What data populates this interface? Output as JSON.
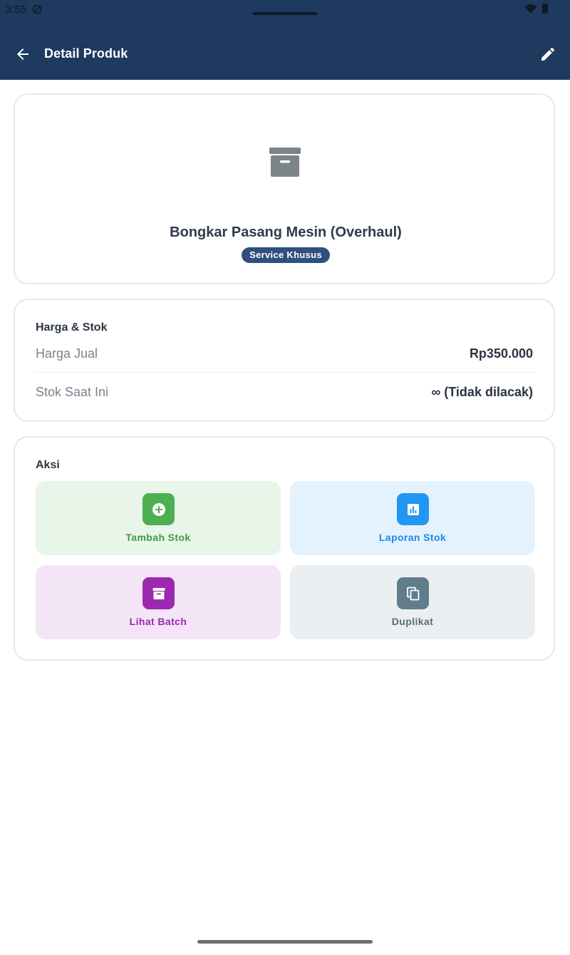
{
  "status_bar": {
    "time": "3:55",
    "icons": [
      "do-not-disturb-icon",
      "wifi-icon",
      "battery-icon"
    ]
  },
  "app_bar": {
    "title": "Detail Produk",
    "back_icon": "arrow-left-icon",
    "edit_icon": "pencil-icon",
    "background": "#1e3a5f"
  },
  "product": {
    "icon": "archive-box-icon",
    "name": "Bongkar Pasang Mesin (Overhaul)",
    "category_badge": "Service Khusus"
  },
  "price_stock": {
    "section_title": "Harga & Stok",
    "rows": [
      {
        "label": "Harga Jual",
        "value": "Rp350.000"
      },
      {
        "label": "Stok Saat Ini",
        "value": "∞ (Tidak dilacak)"
      }
    ]
  },
  "actions": {
    "section_title": "Aksi",
    "items": [
      {
        "label": "Tambah Stok",
        "icon": "plus-circle-icon",
        "color": "#4caf50"
      },
      {
        "label": "Laporan Stok",
        "icon": "bar-chart-icon",
        "color": "#2196f3"
      },
      {
        "label": "Lihat Batch",
        "icon": "archive-icon",
        "color": "#9c27b0"
      },
      {
        "label": "Duplikat",
        "icon": "copy-icon",
        "color": "#607d8b"
      }
    ]
  }
}
